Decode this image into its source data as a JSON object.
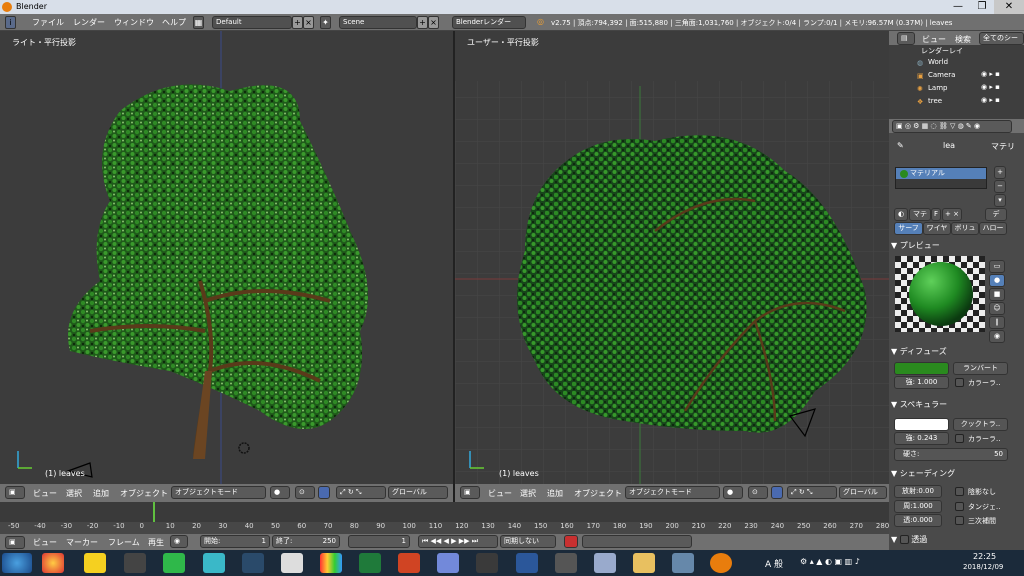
{
  "window": {
    "title": "Blender"
  },
  "menu": {
    "items": [
      "ファイル",
      "レンダー",
      "ウィンドウ",
      "ヘルプ"
    ],
    "layout": "Default",
    "scene": "Scene",
    "engine": "Blenderレンダー",
    "stats": "v2.75 | 頂点:794,392 | 面:515,880 | 三角面:1,031,760 | オブジェクト:0/4 | ランプ:0/1 | メモリ:96.57M (0.37M) | leaves"
  },
  "viewport_left": {
    "label": "ライト・平行投影",
    "footer": "(1) leaves"
  },
  "viewport_right": {
    "label": "ユーザー・平行投影",
    "footer": "(1) leaves"
  },
  "view3d_header": {
    "view": "ビュー",
    "select": "選択",
    "add": "追加",
    "object": "オブジェクト",
    "mode": "オブジェクトモード",
    "orientation": "グローバル"
  },
  "timeline": {
    "ticks": [
      "-50",
      "-40",
      "-30",
      "-20",
      "-10",
      "0",
      "10",
      "20",
      "30",
      "40",
      "50",
      "60",
      "70",
      "80",
      "90",
      "100",
      "110",
      "120",
      "130",
      "140",
      "150",
      "160",
      "170",
      "180",
      "190",
      "200",
      "210",
      "220",
      "230",
      "240",
      "250",
      "260",
      "270",
      "280"
    ],
    "current_frame": "1"
  },
  "timeline_header": {
    "view": "ビュー",
    "marker": "マーカー",
    "frame": "フレーム",
    "playback": "再生",
    "start_label": "開始:",
    "start": "1",
    "end_label": "終了:",
    "end": "250",
    "current": "1",
    "sync": "同期しない"
  },
  "outliner": {
    "view": "ビュー",
    "search": "検索",
    "all_scenes": "全てのシーン",
    "items": [
      "レンダーレイ",
      "World",
      "Camera",
      "Lamp",
      "tree"
    ]
  },
  "properties": {
    "breadcrumb_obj": "lea",
    "breadcrumb_mat": "マテリ",
    "material_name": "マテリアル",
    "tab_mate": "マテ",
    "tab_f": "F",
    "tab_de": "デ",
    "subtabs": [
      "サーフ",
      "ワイヤ",
      "ボリュ",
      "ハロー"
    ],
    "preview_title": "プレビュー",
    "diffuse_title": "ディフューズ",
    "diffuse_shader": "ランバート",
    "diffuse_intensity_label": "強:",
    "diffuse_intensity": "1.000",
    "ramp_label": "カラーラ..",
    "diffuse_color": "#2a8a1e",
    "specular_title": "スペキュラー",
    "specular_shader": "クックトラ..",
    "specular_intensity_label": "強:",
    "specular_intensity": "0.243",
    "specular_ramp": "カラーラ..",
    "hardness_label": "硬さ:",
    "hardness": "50",
    "shading_title": "シェーディング",
    "emit_label": "放射:",
    "emit": "0.00",
    "shadeless": "陰影なし",
    "ambient_label": "周:",
    "ambient": "1.000",
    "tangent": "タンジェ..",
    "translucency_label": "透:",
    "translucency": "0.000",
    "cubic": "三次補間",
    "transparency_title": "透過"
  },
  "taskbar": {
    "time": "22:25",
    "date": "2018/12/09",
    "ime": "A 般"
  }
}
